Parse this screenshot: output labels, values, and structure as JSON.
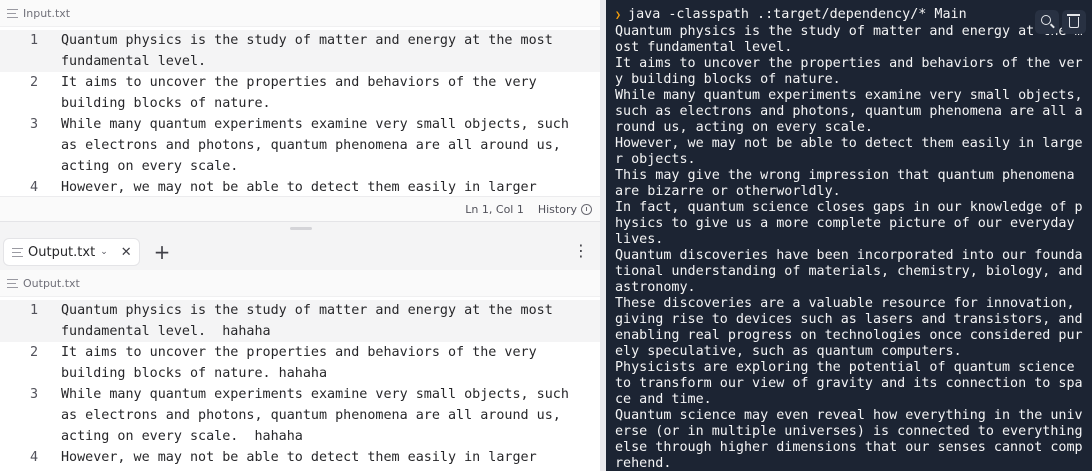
{
  "input_pane": {
    "filename": "Input.txt",
    "lines": [
      {
        "num": "1",
        "text": "Quantum physics is the study of matter and energy at the most fundamental level."
      },
      {
        "num": "2",
        "text": "It aims to uncover the properties and behaviors of the very building blocks of nature."
      },
      {
        "num": "3",
        "text": "While many quantum experiments examine very small objects, such as electrons and photons, quantum phenomena are all around us, acting on every scale."
      },
      {
        "num": "4",
        "text": "However, we may not be able to detect them easily in larger objects."
      }
    ],
    "status": {
      "position": "Ln 1, Col 1",
      "history_label": "History"
    }
  },
  "output_tab": {
    "label": "Output.txt"
  },
  "output_pane": {
    "filename": "Output.txt",
    "lines": [
      {
        "num": "1",
        "text": "Quantum physics is the study of matter and energy at the most fundamental level.  hahaha"
      },
      {
        "num": "2",
        "text": "It aims to uncover the properties and behaviors of the very building blocks of nature. hahaha"
      },
      {
        "num": "3",
        "text": "While many quantum experiments examine very small objects, such as electrons and photons, quantum phenomena are all around us, acting on every scale.  hahaha"
      },
      {
        "num": "4",
        "text": "However, we may not be able to detect them easily in larger"
      }
    ]
  },
  "terminal": {
    "command": "java -classpath .:target/dependency/* Main",
    "output": "Quantum physics is the study of matter and energy at the most fundamental level.\nIt aims to uncover the properties and behaviors of the very building blocks of nature.\nWhile many quantum experiments examine very small objects, such as electrons and photons, quantum phenomena are all around us, acting on every scale.\nHowever, we may not be able to detect them easily in larger objects.\nThis may give the wrong impression that quantum phenomena are bizarre or otherworldly.\nIn fact, quantum science closes gaps in our knowledge of physics to give us a more complete picture of our everyday lives.\nQuantum discoveries have been incorporated into our foundational understanding of materials, chemistry, biology, and astronomy.\nThese discoveries are a valuable resource for innovation, giving rise to devices such as lasers and transistors, and enabling real progress on technologies once considered purely speculative, such as quantum computers.\nPhysicists are exploring the potential of quantum science to transform our view of gravity and its connection to space and time.\nQuantum science may even reveal how everything in the universe (or in multiple universes) is connected to everything else through higher dimensions that our senses cannot comprehend."
  },
  "icons": {
    "file": "lines-icon",
    "history": "clock-icon",
    "search": "search-icon",
    "clear": "trash-icon",
    "prompt": "chevron-right-icon"
  },
  "colors": {
    "terminal_bg": "#1c2433",
    "prompt_accent": "#f59e0b"
  }
}
